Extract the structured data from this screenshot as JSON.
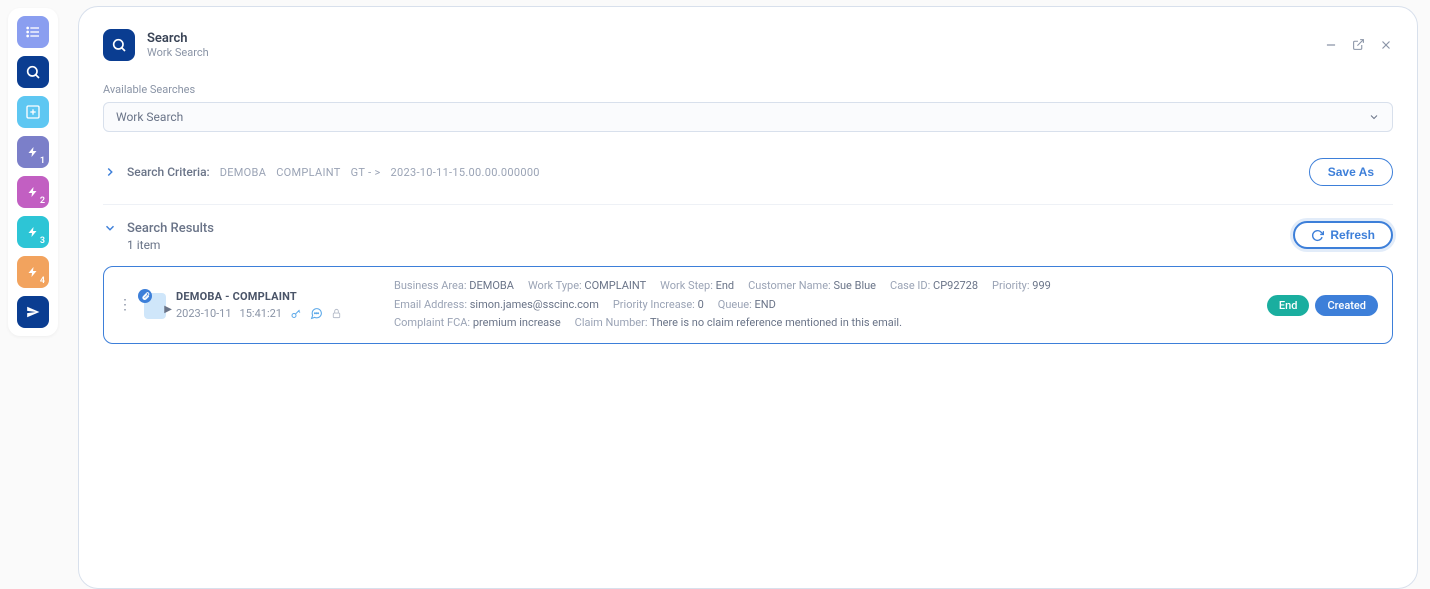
{
  "sidebar": {
    "items": [
      {
        "name": "list"
      },
      {
        "name": "search"
      },
      {
        "name": "add"
      },
      {
        "name": "bolt1",
        "sub": "1"
      },
      {
        "name": "bolt2",
        "sub": "2"
      },
      {
        "name": "bolt3",
        "sub": "3"
      },
      {
        "name": "bolt4",
        "sub": "4"
      },
      {
        "name": "send"
      }
    ]
  },
  "header": {
    "title": "Search",
    "subtitle": "Work Search"
  },
  "available_searches": {
    "label": "Available Searches",
    "value": "Work Search"
  },
  "criteria": {
    "label": "Search Criteria:",
    "tokens": [
      "DEMOBA",
      "COMPLAINT",
      "GT - >",
      "2023-10-11-15.00.00.000000"
    ],
    "save_as": "Save As"
  },
  "results": {
    "title": "Search Results",
    "count_text": "1 item",
    "refresh": "Refresh"
  },
  "card": {
    "title": "DEMOBA - COMPLAINT",
    "date": "2023-10-11",
    "time": "15:41:21",
    "fields": [
      {
        "label": "Business Area:",
        "value": "DEMOBA"
      },
      {
        "label": "Work Type:",
        "value": "COMPLAINT"
      },
      {
        "label": "Work Step:",
        "value": "End"
      },
      {
        "label": "Customer Name:",
        "value": "Sue Blue"
      },
      {
        "label": "Case ID:",
        "value": "CP92728"
      },
      {
        "label": "Priority:",
        "value": "999"
      },
      {
        "label": "Email Address:",
        "value": "simon.james@sscinc.com"
      },
      {
        "label": "Priority Increase:",
        "value": "0"
      },
      {
        "label": "Queue:",
        "value": "END"
      },
      {
        "label": "Complaint FCA:",
        "value": "premium increase"
      },
      {
        "label": "Claim Number:",
        "value": "There is no claim reference mentioned in this email."
      }
    ],
    "badges": {
      "status": "End",
      "state": "Created"
    }
  }
}
